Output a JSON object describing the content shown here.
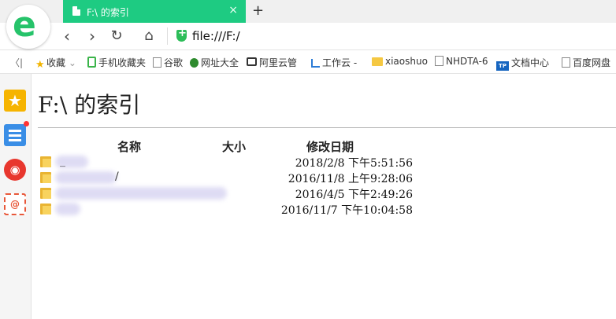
{
  "browser": {
    "tab": {
      "title": "F:\\ 的索引",
      "close": "×"
    },
    "new_tab": "+",
    "nav": {
      "back": "‹",
      "forward": "›",
      "reload": "↻",
      "home": "⌂"
    },
    "url": "file:///F:/"
  },
  "bookmarks": {
    "collapse": "〈|",
    "items": [
      {
        "label": "收藏",
        "icon": "star-icon"
      },
      {
        "label": "手机收藏夹",
        "icon": "phone-icon"
      },
      {
        "label": "谷歌",
        "icon": "page-icon"
      },
      {
        "label": "网址大全",
        "icon": "globe-icon"
      },
      {
        "label": "阿里云管",
        "icon": "aliyun-icon"
      },
      {
        "label": "工作云 -",
        "icon": "chart-icon"
      },
      {
        "label": "xiaoshuo",
        "icon": "folder-icon"
      },
      {
        "label": "NHDTA-6",
        "icon": "page-icon"
      },
      {
        "label": "文档中心",
        "icon": "tp-icon"
      },
      {
        "label": "百度网盘",
        "icon": "page-icon"
      }
    ]
  },
  "sidebar": {
    "items": [
      "favorites-star-icon",
      "news-icon",
      "weibo-icon",
      "mail-icon"
    ]
  },
  "listing": {
    "heading": "F:\\  的索引",
    "columns": {
      "name": "名称",
      "size": "大小",
      "date": "修改日期"
    },
    "rows": [
      {
        "name": "_",
        "date": "2018/2/8 下午5:51:56"
      },
      {
        "name": "/",
        "date": "2016/11/8 上午9:28:06"
      },
      {
        "name": "",
        "date": "2016/4/5 下午2:49:26"
      },
      {
        "name": "",
        "date": "2016/11/7 下午10:04:58"
      }
    ]
  },
  "colors": {
    "tab_active": "#1ecb82",
    "logo_green": "#26c36a"
  }
}
